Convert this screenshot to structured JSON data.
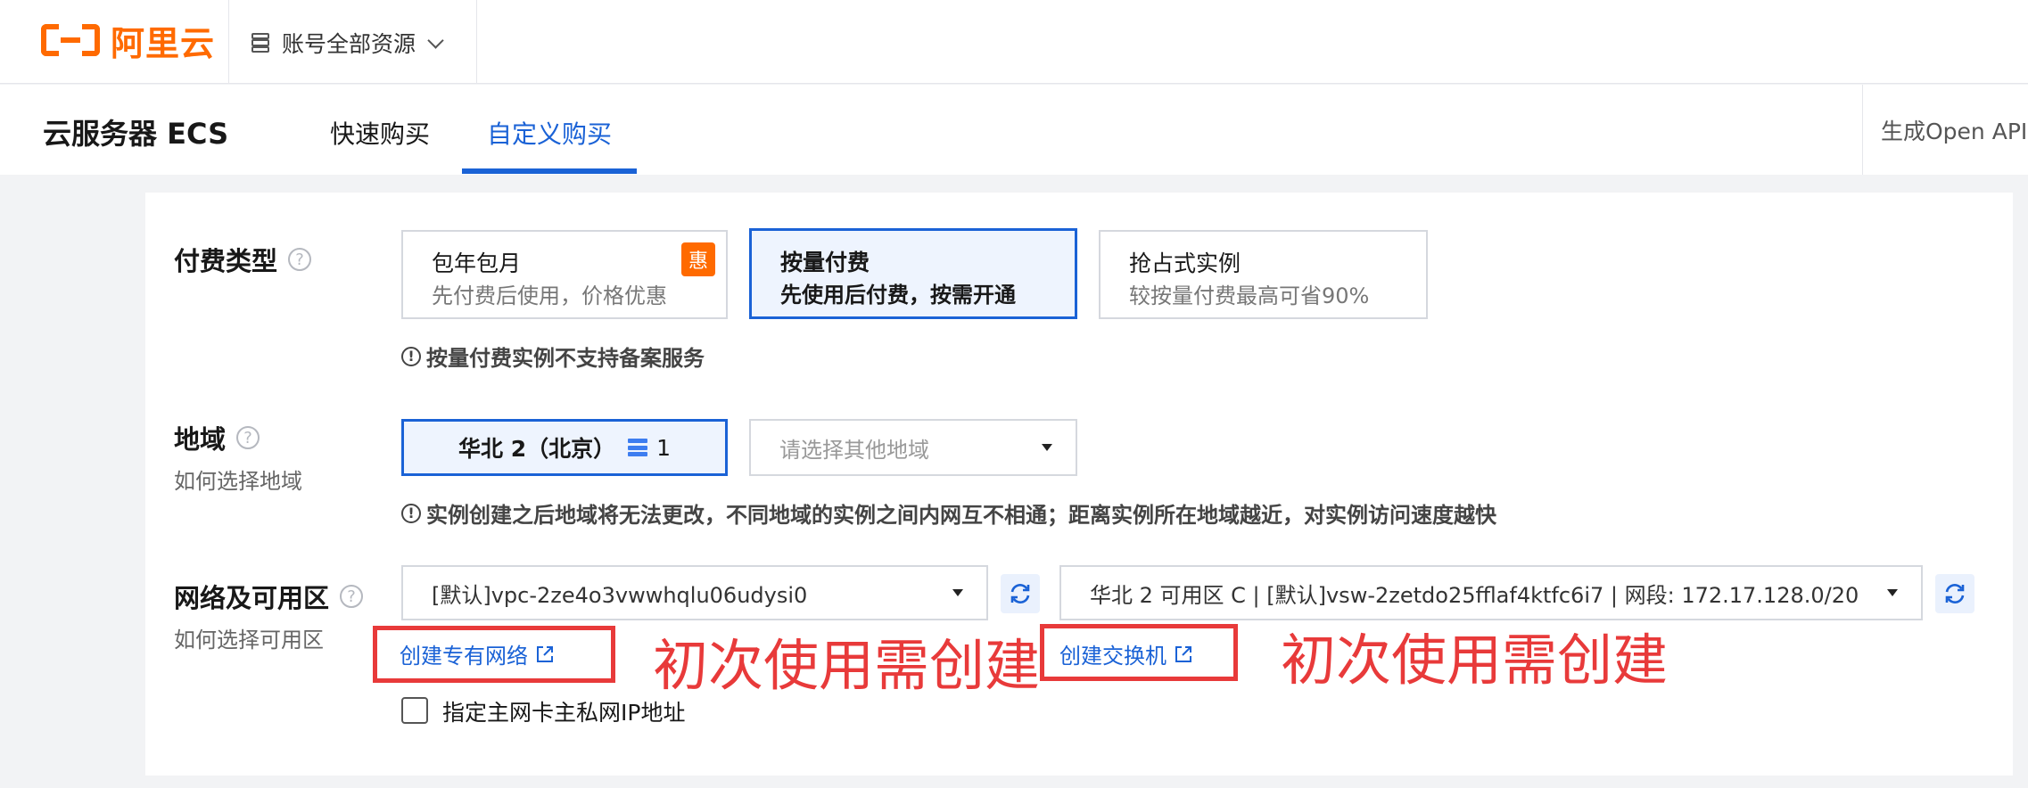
{
  "header": {
    "logo_text": "阿里云",
    "account_label": "账号全部资源",
    "product_title": "云服务器 ECS",
    "tabs": [
      {
        "label": "快速购买",
        "active": false
      },
      {
        "label": "自定义购买",
        "active": true
      }
    ],
    "openapi_label": "生成Open API最"
  },
  "billing": {
    "label": "付费类型",
    "options": [
      {
        "title": "包年包月",
        "desc": "先付费后使用，价格优惠",
        "badge": "惠",
        "selected": false
      },
      {
        "title": "按量付费",
        "desc": "先使用后付费，按需开通",
        "selected": true
      },
      {
        "title": "抢占式实例",
        "desc": "较按量付费最高可省90%",
        "selected": false
      }
    ],
    "note": "按量付费实例不支持备案服务"
  },
  "region": {
    "label": "地域",
    "help_link": "如何选择地域",
    "selected": "华北 2（北京）",
    "selected_count": "1",
    "other_placeholder": "请选择其他地域",
    "note": "实例创建之后地域将无法更改，不同地域的实例之间内网互不相通；距离实例所在地域越近，对实例访问速度越快"
  },
  "network": {
    "label": "网络及可用区",
    "help_link": "如何选择可用区",
    "vpc_value": "[默认]vpc-2ze4o3vwwhqlu06udysi0",
    "vswitch_value": "华北 2 可用区 C | [默认]vsw-2zetdo25fflaf4ktfc6i7 | 网段: 172.17.128.0/20",
    "create_vpc_link": "创建专有网络",
    "create_vswitch_link": "创建交换机",
    "annotation_text": "初次使用需创建",
    "checkbox_label": "指定主网卡主私网IP地址"
  },
  "colors": {
    "brand_orange": "#ff6a00",
    "primary_blue": "#1a62d6",
    "annotation_red": "#e83a3a"
  }
}
